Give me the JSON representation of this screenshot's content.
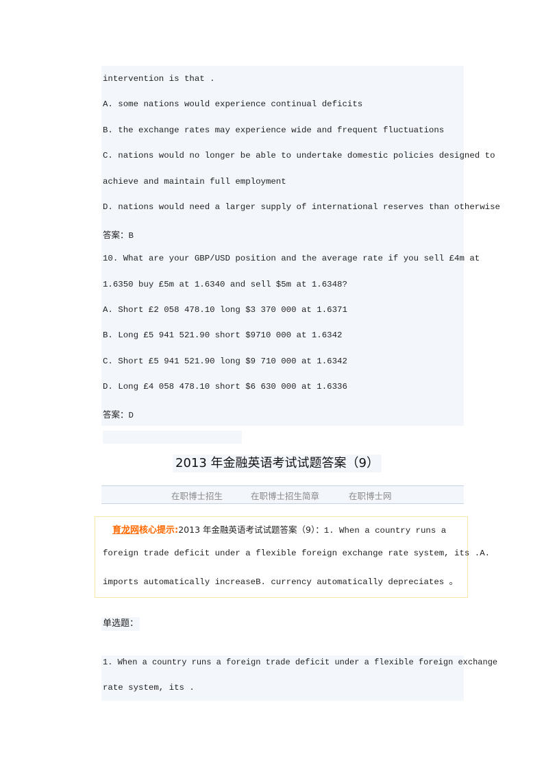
{
  "question9": {
    "lines": [
      "intervention is that .",
      "A. some nations would experience continual deficits",
      "B. the exchange rates may experience wide and frequent fluctuations",
      "C. nations would no longer be able to undertake domestic policies designed to",
      "achieve and maintain full employment",
      "D. nations would need a larger supply of international reserves than otherwise"
    ],
    "answer_label": "答案：",
    "answer": "B"
  },
  "question10": {
    "lines": [
      "10. What are your GBP/USD position and the average rate if you sell £4m at",
      "1.6350 buy £5m at 1.6340 and sell $5m at 1.6348?",
      "A. Short £2 058 478.10 long $3 370 000 at 1.6371",
      "B. Long £5 941 521.90 short $9710 000 at 1.6342",
      "C. Short £5 941 521.90 long $9 710 000 at 1.6342",
      "D. Long £4 058 478.10 short $6 630 000 at 1.6336"
    ],
    "answer_label": "答案：",
    "answer": "D"
  },
  "article": {
    "title": "2013 年金融英语考试试题答案（9）",
    "nav_links": [
      "在职博士招生",
      "在职博士招生简章",
      "在职博士网"
    ],
    "tip": {
      "site": "育龙网",
      "label_suffix": "核心提示:",
      "title_ref": "2013 年金融英语考试试题答案（9）：",
      "line1_rest": "1. When a country runs a",
      "line2": "foreign trade deficit under a flexible foreign exchange rate system, its .A.",
      "line3": "imports automatically increaseB. currency automatically depreciates 。"
    },
    "section_label": "单选题：",
    "question1": {
      "lines": [
        "1. When a country runs a foreign trade deficit under a flexible foreign exchange",
        "rate system, its ."
      ]
    }
  }
}
